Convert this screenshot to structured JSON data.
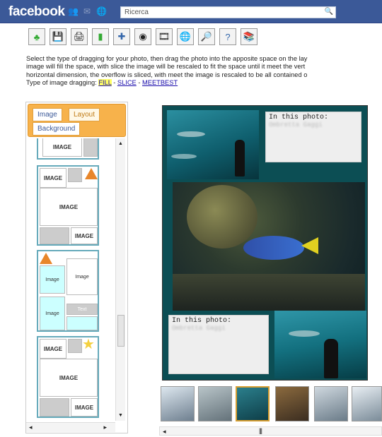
{
  "header": {
    "logo": "facebook",
    "search_placeholder": "Ricerca"
  },
  "toolbar": {
    "buttons": [
      {
        "icon": "leaf-icon"
      },
      {
        "icon": "save-icon"
      },
      {
        "icon": "print-icon"
      },
      {
        "icon": "book-icon"
      },
      {
        "icon": "plus-icon"
      },
      {
        "icon": "camera-icon"
      },
      {
        "icon": "film-icon"
      },
      {
        "icon": "globe-icon"
      },
      {
        "icon": "globe-search-icon"
      },
      {
        "icon": "help-icon"
      },
      {
        "icon": "stack-icon"
      }
    ]
  },
  "instructions": {
    "line1": "Select the type of dragging for your photo, then drag the photo into the apposite space on the lay",
    "line2": "image will fill the space, with slice the image will be rescaled to fit the space until it meet the vert",
    "line3": "horizontal dimension, the overflow is sliced, with meet the image is rescaled to be all contained o",
    "type_label": "Type of image dragging:",
    "options": [
      "FILL",
      "SLICE",
      "MEETBEST"
    ],
    "separator": " - "
  },
  "panel": {
    "tabs": [
      "Image",
      "Layout",
      "Background"
    ],
    "active_tab": "Layout",
    "layout_labels": {
      "image_upper": "IMAGE",
      "image_lower": "Image",
      "text": "Text"
    }
  },
  "collage": {
    "caption_title": "In this photo:",
    "caption_name": "Ombretta Gaggi"
  },
  "colors": {
    "facebook_blue": "#3b5998",
    "tab_orange": "#f7b24b",
    "highlight": "#ffff66",
    "layout_cyan": "#ccffff"
  }
}
